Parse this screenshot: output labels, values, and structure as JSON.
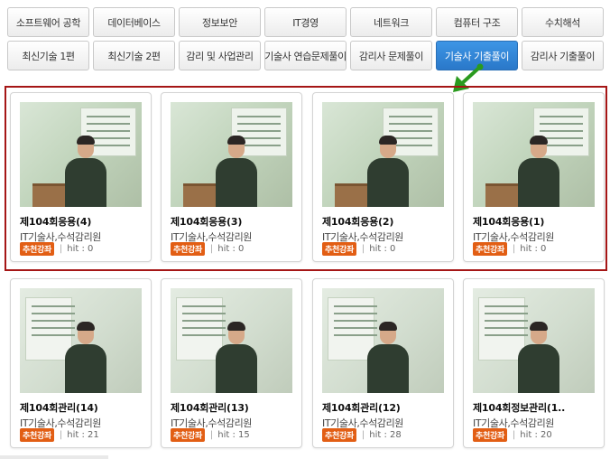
{
  "tabs": {
    "row1": [
      "소프트웨어 공학",
      "데이터베이스",
      "정보보안",
      "IT경영",
      "네트워크",
      "컴퓨터 구조",
      "수치해석"
    ],
    "row2": [
      "최신기술 1편",
      "최신기술 2편",
      "감리 및 사업관리",
      "기술사 연습문제풀이",
      "감리사 문제풀이",
      "기술사 기출풀이",
      "감리사 기출풀이"
    ],
    "active_tab": "기술사 기출풀이",
    "active_color": "#2f80d1"
  },
  "highlight": {
    "border_color": "#a51616",
    "arrow_color": "#2a9a1e",
    "arrow_icon": "arrow-down-left-icon"
  },
  "badge_color": "#e25e14",
  "cards": [
    {
      "title": "제104회응용(4)",
      "author": "IT기술사,수석감리원",
      "badge": "추천강좌",
      "hit_label": "hit : 0"
    },
    {
      "title": "제104회응용(3)",
      "author": "IT기술사,수석감리원",
      "badge": "추천강좌",
      "hit_label": "hit : 0"
    },
    {
      "title": "제104회응용(2)",
      "author": "IT기술사,수석감리원",
      "badge": "추천강좌",
      "hit_label": "hit : 0"
    },
    {
      "title": "제104회응용(1)",
      "author": "IT기술사,수석감리원",
      "badge": "추천강좌",
      "hit_label": "hit : 0"
    },
    {
      "title": "제104회관리(14)",
      "author": "IT기술사,수석감리원",
      "badge": "추천강좌",
      "hit_label": "hit : 21"
    },
    {
      "title": "제104회관리(13)",
      "author": "IT기술사,수석감리원",
      "badge": "추천강좌",
      "hit_label": "hit : 15"
    },
    {
      "title": "제104회관리(12)",
      "author": "IT기술사,수석감리원",
      "badge": "추천강좌",
      "hit_label": "hit : 28"
    },
    {
      "title": "제104회정보관리(1..",
      "author": "IT기술사,수석감리원",
      "badge": "추천강좌",
      "hit_label": "hit : 20"
    }
  ]
}
